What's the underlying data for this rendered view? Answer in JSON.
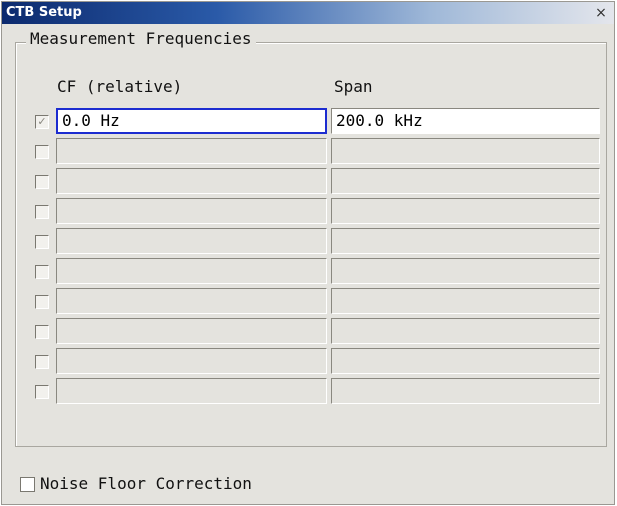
{
  "window": {
    "title": "CTB Setup",
    "close_glyph": "×"
  },
  "group": {
    "title": "Measurement Frequencies"
  },
  "columns": {
    "cf": "CF (relative)",
    "span": "Span"
  },
  "rows": [
    {
      "checked": true,
      "cf": "0.0 Hz",
      "span": "200.0 kHz",
      "active": true
    },
    {
      "checked": false,
      "cf": "",
      "span": ""
    },
    {
      "checked": false,
      "cf": "",
      "span": ""
    },
    {
      "checked": false,
      "cf": "",
      "span": ""
    },
    {
      "checked": false,
      "cf": "",
      "span": ""
    },
    {
      "checked": false,
      "cf": "",
      "span": ""
    },
    {
      "checked": false,
      "cf": "",
      "span": ""
    },
    {
      "checked": false,
      "cf": "",
      "span": ""
    },
    {
      "checked": false,
      "cf": "",
      "span": ""
    },
    {
      "checked": false,
      "cf": "",
      "span": ""
    }
  ],
  "noise_floor": {
    "label": "Noise Floor Correction",
    "checked": false
  },
  "colors": {
    "focus": "#1c2cd0",
    "dialog_bg": "#e4e3de",
    "title_start": "#0c2a6e"
  }
}
